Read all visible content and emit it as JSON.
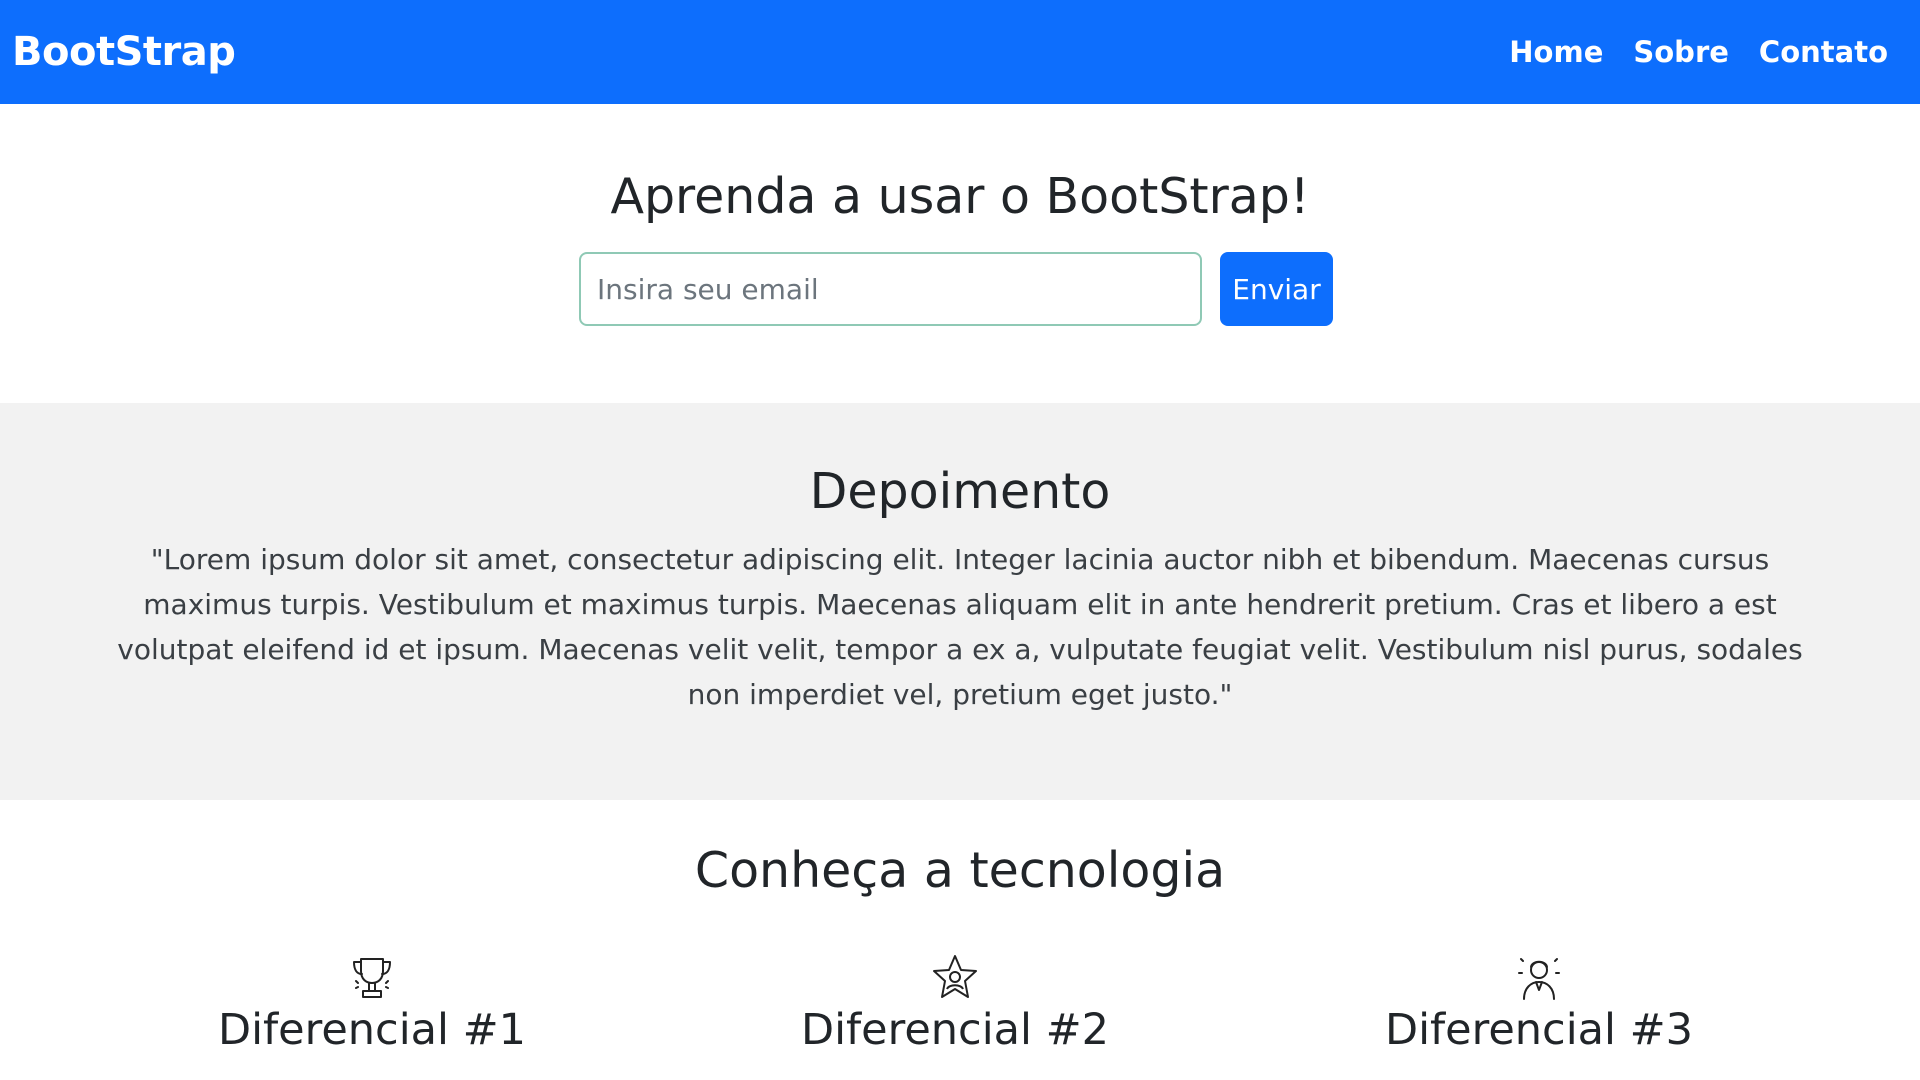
{
  "navbar": {
    "brand": "BootStrap",
    "links": [
      "Home",
      "Sobre",
      "Contato"
    ]
  },
  "hero": {
    "title": "Aprenda a usar o BootStrap!",
    "email_placeholder": "Insira seu email",
    "email_value": "",
    "send_label": "Enviar"
  },
  "testimonial": {
    "title": "Depoimento",
    "text": "\"Lorem ipsum dolor sit amet, consectetur adipiscing elit. Integer lacinia auctor nibh et bibendum. Maecenas cursus maximus turpis. Vestibulum et maximus turpis. Maecenas aliquam elit in ante hendrerit pretium. Cras et libero a est volutpat eleifend id et ipsum. Maecenas velit velit, tempor a ex a, vulputate feugiat velit. Vestibulum nisl purus, sodales non imperdiet vel, pretium eget justo.\""
  },
  "tech": {
    "title": "Conheça a tecnologia",
    "features": [
      {
        "icon": "trophy-icon",
        "title": "Diferencial #1"
      },
      {
        "icon": "star-badge-icon",
        "title": "Diferencial #2"
      },
      {
        "icon": "person-icon",
        "title": "Diferencial #3"
      }
    ]
  },
  "colors": {
    "primary": "#0d6efd",
    "section_bg": "#f2f2f2",
    "text": "#212529"
  }
}
